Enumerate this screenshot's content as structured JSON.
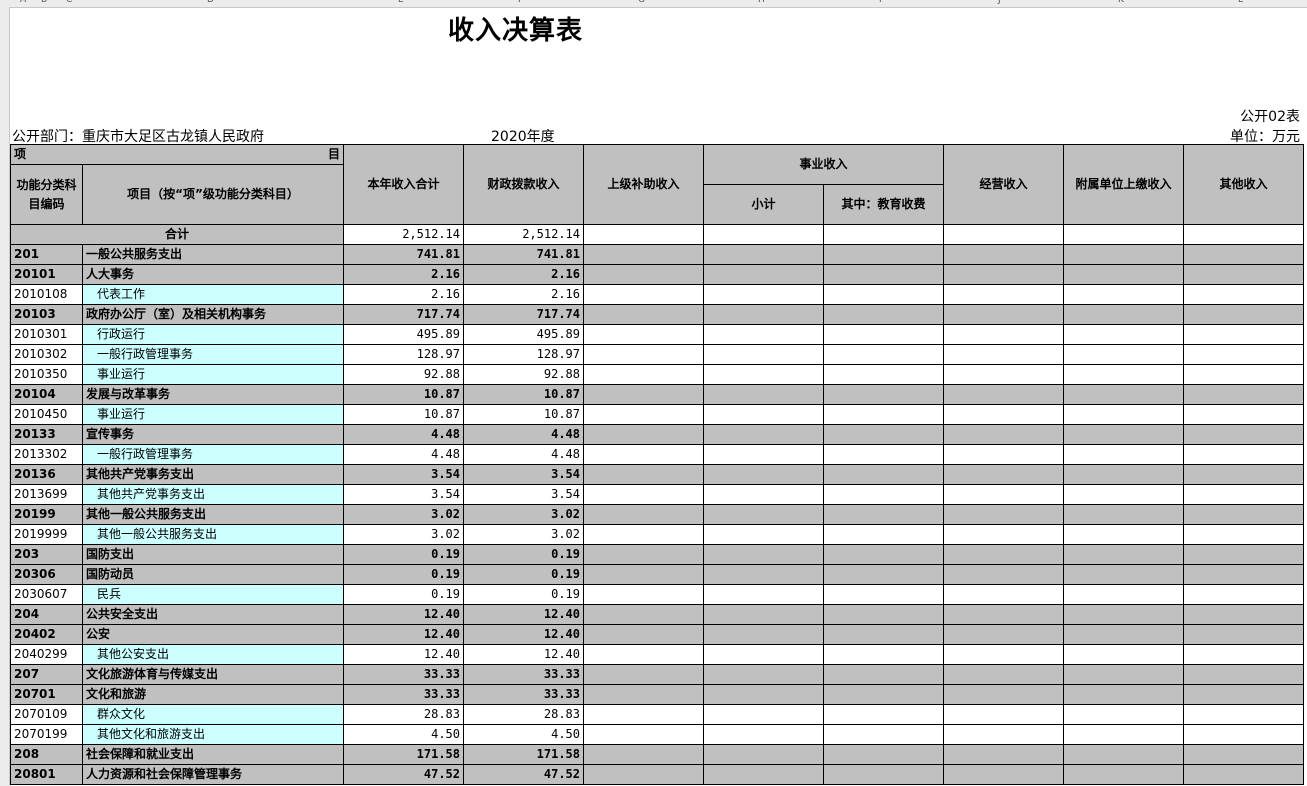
{
  "column_letters": [
    "A",
    "B",
    "C",
    "D",
    "E",
    "F",
    "G",
    "H",
    "I",
    "J",
    "K",
    "L"
  ],
  "title": "收入决算表",
  "form_no": "公开02表",
  "department": "公开部门：重庆市大足区古龙镇人民政府",
  "year": "2020年度",
  "unit": "单位：万元",
  "headers": {
    "item_left": "项",
    "item_right": "目",
    "code": "功能分类科目编码",
    "name": "项目（按“项”级功能分类科目）",
    "total_income": "本年收入合计",
    "fiscal": "财政拨款收入",
    "superior": "上级补助收入",
    "business": "事业收入",
    "business_subtotal": "小计",
    "business_edu": "其中：教育收费",
    "operating": "经营收入",
    "affiliated": "附属单位上缴收入",
    "other": "其他收入"
  },
  "total_row": {
    "label": "合计",
    "total": "2,512.14",
    "fiscal": "2,512.14"
  },
  "rows": [
    {
      "code": "201",
      "name": "一般公共服务支出",
      "total": "741.81",
      "fiscal": "741.81",
      "level": "bold"
    },
    {
      "code": "20101",
      "name": "人大事务",
      "total": "2.16",
      "fiscal": "2.16",
      "level": "bold"
    },
    {
      "code": "2010108",
      "name": "代表工作",
      "total": "2.16",
      "fiscal": "2.16",
      "level": "leaf"
    },
    {
      "code": "20103",
      "name": "政府办公厅（室）及相关机构事务",
      "total": "717.74",
      "fiscal": "717.74",
      "level": "bold"
    },
    {
      "code": "2010301",
      "name": "行政运行",
      "total": "495.89",
      "fiscal": "495.89",
      "level": "leaf"
    },
    {
      "code": "2010302",
      "name": "一般行政管理事务",
      "total": "128.97",
      "fiscal": "128.97",
      "level": "leaf"
    },
    {
      "code": "2010350",
      "name": "事业运行",
      "total": "92.88",
      "fiscal": "92.88",
      "level": "leaf"
    },
    {
      "code": "20104",
      "name": "发展与改革事务",
      "total": "10.87",
      "fiscal": "10.87",
      "level": "bold"
    },
    {
      "code": "2010450",
      "name": "事业运行",
      "total": "10.87",
      "fiscal": "10.87",
      "level": "leaf"
    },
    {
      "code": "20133",
      "name": "宣传事务",
      "total": "4.48",
      "fiscal": "4.48",
      "level": "bold"
    },
    {
      "code": "2013302",
      "name": "一般行政管理事务",
      "total": "4.48",
      "fiscal": "4.48",
      "level": "leaf"
    },
    {
      "code": "20136",
      "name": "其他共产党事务支出",
      "total": "3.54",
      "fiscal": "3.54",
      "level": "bold"
    },
    {
      "code": "2013699",
      "name": "其他共产党事务支出",
      "total": "3.54",
      "fiscal": "3.54",
      "level": "leaf"
    },
    {
      "code": "20199",
      "name": "其他一般公共服务支出",
      "total": "3.02",
      "fiscal": "3.02",
      "level": "bold"
    },
    {
      "code": "2019999",
      "name": "其他一般公共服务支出",
      "total": "3.02",
      "fiscal": "3.02",
      "level": "leaf"
    },
    {
      "code": "203",
      "name": "国防支出",
      "total": "0.19",
      "fiscal": "0.19",
      "level": "bold"
    },
    {
      "code": "20306",
      "name": "国防动员",
      "total": "0.19",
      "fiscal": "0.19",
      "level": "bold"
    },
    {
      "code": "2030607",
      "name": "民兵",
      "total": "0.19",
      "fiscal": "0.19",
      "level": "leaf"
    },
    {
      "code": "204",
      "name": "公共安全支出",
      "total": "12.40",
      "fiscal": "12.40",
      "level": "bold"
    },
    {
      "code": "20402",
      "name": "公安",
      "total": "12.40",
      "fiscal": "12.40",
      "level": "bold"
    },
    {
      "code": "2040299",
      "name": "其他公安支出",
      "total": "12.40",
      "fiscal": "12.40",
      "level": "leaf"
    },
    {
      "code": "207",
      "name": "文化旅游体育与传媒支出",
      "total": "33.33",
      "fiscal": "33.33",
      "level": "bold"
    },
    {
      "code": "20701",
      "name": "文化和旅游",
      "total": "33.33",
      "fiscal": "33.33",
      "level": "bold"
    },
    {
      "code": "2070109",
      "name": "群众文化",
      "total": "28.83",
      "fiscal": "28.83",
      "level": "leaf"
    },
    {
      "code": "2070199",
      "name": "其他文化和旅游支出",
      "total": "4.50",
      "fiscal": "4.50",
      "level": "leaf"
    },
    {
      "code": "208",
      "name": "社会保障和就业支出",
      "total": "171.58",
      "fiscal": "171.58",
      "level": "bold"
    },
    {
      "code": "20801",
      "name": "人力资源和社会保障管理事务",
      "total": "47.52",
      "fiscal": "47.52",
      "level": "bold"
    }
  ]
}
